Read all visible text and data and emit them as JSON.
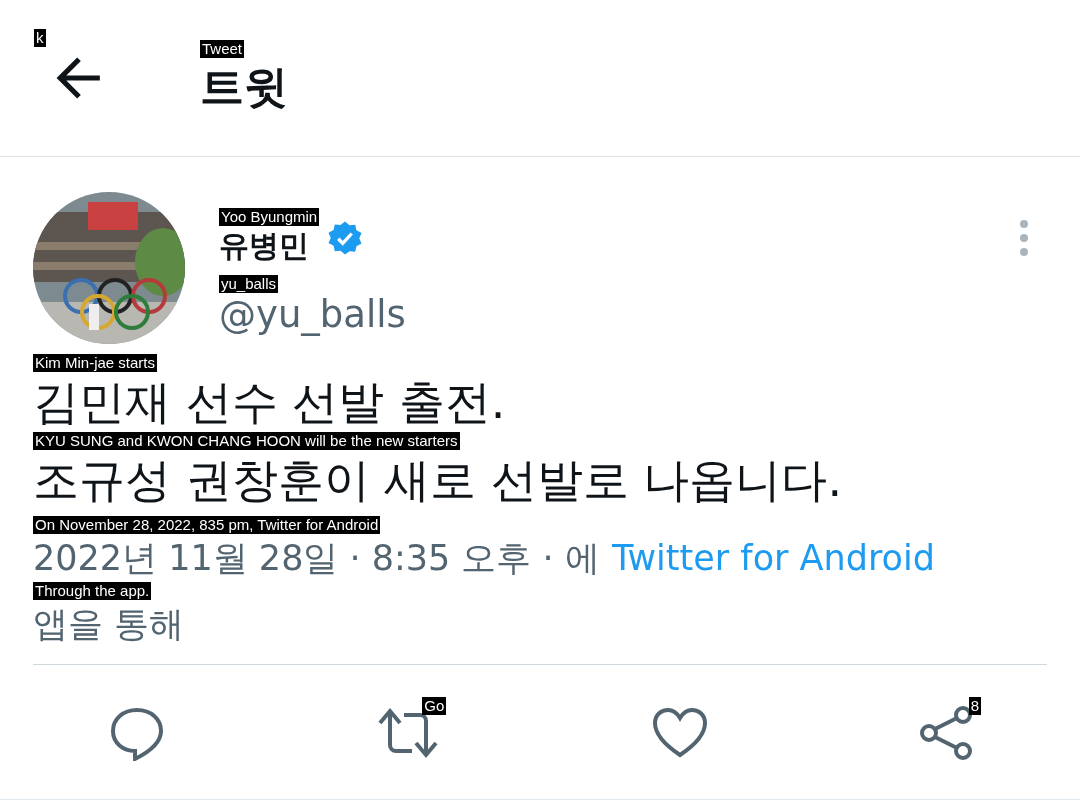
{
  "header": {
    "back_overlay": "k",
    "title": "트윗",
    "title_overlay": "Tweet"
  },
  "author": {
    "name": "유병민",
    "name_overlay": "Yoo Byungmin",
    "verified": true,
    "handle": "@yu_balls",
    "handle_overlay": "yu_balls"
  },
  "tweet_lines": [
    {
      "text": "김민재 선수 선발 출전.",
      "overlay": "Kim Min-jae starts"
    },
    {
      "text": "조규성 권창훈이 새로 선발로 나옵니다.",
      "overlay": "KYU SUNG and KWON CHANG HOON will be the new starters"
    }
  ],
  "meta": {
    "date": "2022년 11월 28일 · 8:35 오후 · 에",
    "source": "Twitter for Android",
    "date_overlay": "On November 28, 2022, 835 pm, Twitter for Android",
    "suffix": "앱을 통해",
    "suffix_overlay": "Through the app."
  },
  "actions": [
    {
      "kind": "reply"
    },
    {
      "kind": "retweet",
      "overlay": "Go"
    },
    {
      "kind": "like"
    },
    {
      "kind": "share",
      "overlay": "8"
    }
  ]
}
